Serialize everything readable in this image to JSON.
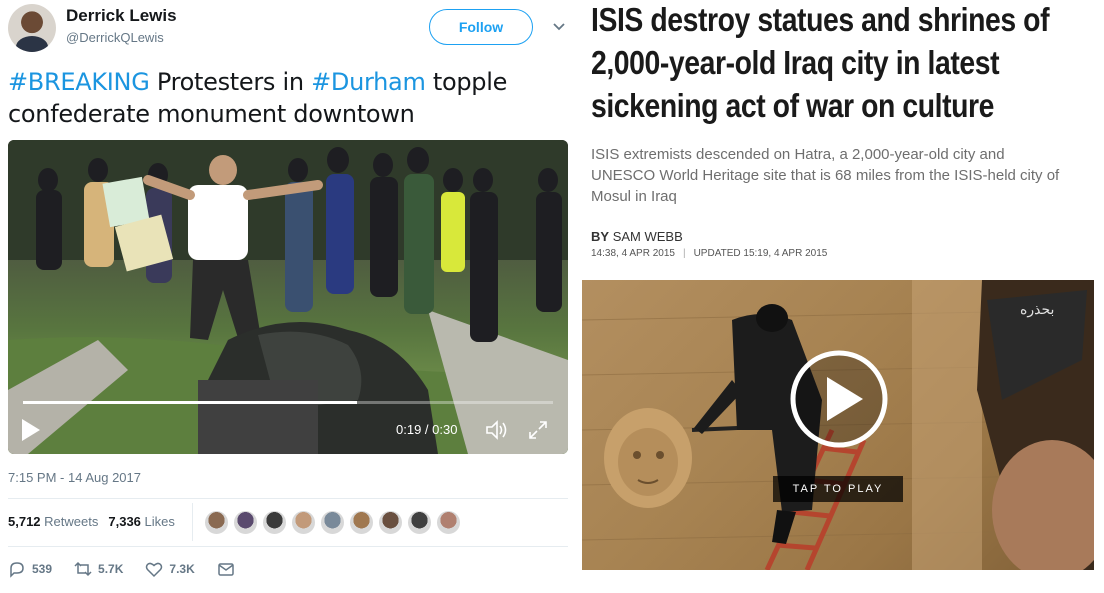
{
  "tweet": {
    "author_name": "Derrick Lewis",
    "author_handle": "@DerrickQLewis",
    "follow_label": "Follow",
    "text_parts": [
      {
        "text": "#BREAKING",
        "hashtag": true
      },
      {
        "text": " Protesters in ",
        "hashtag": false
      },
      {
        "text": "#Durham",
        "hashtag": true
      },
      {
        "text": " topple confederate monument downtown",
        "hashtag": false
      }
    ],
    "video": {
      "time": "0:19 / 0:30",
      "progress": 0.63
    },
    "timestamp": "7:15 PM - 14 Aug 2017",
    "retweets_count": "5,712",
    "retweets_label": "Retweets",
    "likes_count": "7,336",
    "likes_label": "Likes",
    "liker_colors": [
      "#8a6a52",
      "#5a4a6e",
      "#3b3b3b",
      "#c29a7a",
      "#7a8a9a",
      "#a07850",
      "#6a5040",
      "#404040",
      "#b08070"
    ],
    "actions": {
      "reply_count": "539",
      "retweet_count": "5.7K",
      "like_count": "7.3K"
    },
    "colors": {
      "accent": "#1da1f2",
      "hashtag": "#1b95e0",
      "muted": "#657786"
    }
  },
  "article": {
    "headline": "ISIS destroy statues and shrines of 2,000-year-old Iraq city in latest sickening act of war on culture",
    "subhead": "ISIS extremists descended on Hatra, a 2,000-year-old city and UNESCO World Heritage site that is 68 miles from the ISIS-held city of Mosul in Iraq",
    "byline_prefix": "BY",
    "byline_author": "SAM WEBB",
    "published": "14:38, 4 APR 2015",
    "updated": "UPDATED 15:19, 4 APR 2015",
    "tap_label": "TAP TO PLAY",
    "watermark": "بحذره"
  }
}
